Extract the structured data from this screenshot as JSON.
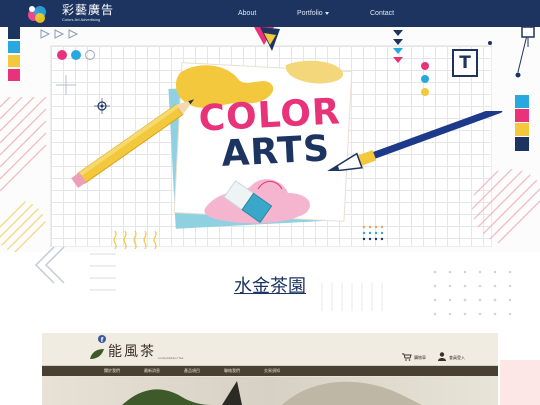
{
  "brand": {
    "name": "彩藝廣告",
    "tagline": "Colors Art Advertising",
    "logo_colors": [
      "#e94a8b",
      "#29a8e0",
      "#f5d020"
    ]
  },
  "nav": {
    "items": [
      {
        "label": "About"
      },
      {
        "label": "Portfolio"
      },
      {
        "label": "Contact"
      }
    ]
  },
  "hero": {
    "line1": "COLOR",
    "line2": "ARTS",
    "badge_letter": "T",
    "colors": {
      "pink": "#e8337a",
      "blue": "#1d3a8a",
      "yellow": "#f3c83c",
      "teal": "#8fd1e0",
      "navy": "#1d3461"
    }
  },
  "section": {
    "title": "水金茶園"
  },
  "preview": {
    "logo_text": "能風茶",
    "subtitle": "Limited Edition Tea",
    "cart_label": "購物車",
    "member_label": "會員登入",
    "nav_items": [
      "關於我們",
      "最新消息",
      "產品項目",
      "聯絡我們",
      "交易須知"
    ]
  }
}
